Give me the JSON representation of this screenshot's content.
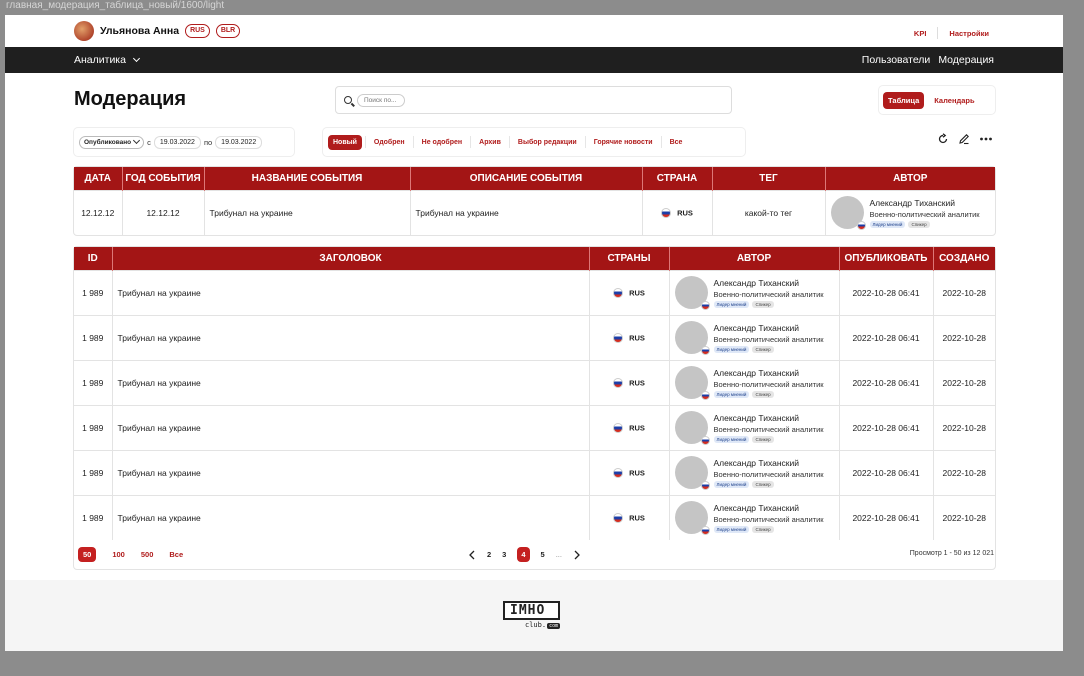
{
  "frame_title": "главная_модерация_таблица_новый/1600/light",
  "user": {
    "name": "Ульянова Анна",
    "langs": [
      "RUS",
      "BLR"
    ]
  },
  "top_links": {
    "kpi": "KPI",
    "settings": "Настройки"
  },
  "nav": {
    "analytics": "Аналитика",
    "users": "Пользователи",
    "moderation": "Модерация"
  },
  "page": {
    "title": "Модерация"
  },
  "search": {
    "placeholder": "Поиск по..."
  },
  "view_tabs": {
    "table": "Таблица",
    "calendar": "Календарь",
    "active": "Таблица"
  },
  "filters": {
    "status_select": "Опубликовано",
    "from_label": "с",
    "from_date": "19.03.2022",
    "to_label": "по",
    "to_date": "19.03.2022"
  },
  "status_tabs": [
    "Новый",
    "Одобрен",
    "Не одобрен",
    "Архив",
    "Выбор редакции",
    "Горячие новости",
    "Все"
  ],
  "status_active": "Новый",
  "events_table": {
    "headers": [
      "ДАТА",
      "ГОД СОБЫТИЯ",
      "НАЗВАНИЕ СОБЫТИЯ",
      "ОПИСАНИЕ СОБЫТИЯ",
      "СТРАНА",
      "ТЕГ",
      "АВТОР"
    ],
    "row": {
      "date": "12.12.12",
      "year": "12.12.12",
      "name": "Трибунал на украине",
      "description": "Трибунал на украине",
      "country": "RUS",
      "tag": "какой-то тег",
      "author_name": "Александр Тиханский",
      "author_role": "Военно-политический аналитик",
      "author_tags": [
        "Лидер мнений",
        "Спикер"
      ]
    }
  },
  "articles_table": {
    "headers": [
      "ID",
      "ЗАГОЛОВОК",
      "СТРАНЫ",
      "АВТОР",
      "ОПУБЛИКОВАТЬ",
      "СОЗДАНО"
    ],
    "rows": [
      {
        "id": "1 989",
        "title": "Трибунал на украине",
        "country": "RUS",
        "author_name": "Александр Тиханский",
        "author_role": "Военно-политический аналитик",
        "tag1": "Лидер мнений",
        "tag2": "Спикер",
        "publish": "2022-10-28 06:41",
        "created": "2022-10-28"
      },
      {
        "id": "1 989",
        "title": "Трибунал на украине",
        "country": "RUS",
        "author_name": "Александр Тиханский",
        "author_role": "Военно-политический аналитик",
        "tag1": "Лидер мнений",
        "tag2": "Спикер",
        "publish": "2022-10-28 06:41",
        "created": "2022-10-28"
      },
      {
        "id": "1 989",
        "title": "Трибунал на украине",
        "country": "RUS",
        "author_name": "Александр Тиханский",
        "author_role": "Военно-политический аналитик",
        "tag1": "Лидер мнений",
        "tag2": "Спикер",
        "publish": "2022-10-28 06:41",
        "created": "2022-10-28"
      },
      {
        "id": "1 989",
        "title": "Трибунал на украине",
        "country": "RUS",
        "author_name": "Александр Тиханский",
        "author_role": "Военно-политический аналитик",
        "tag1": "Лидер мнений",
        "tag2": "Спикер",
        "publish": "2022-10-28 06:41",
        "created": "2022-10-28"
      },
      {
        "id": "1 989",
        "title": "Трибунал на украине",
        "country": "RUS",
        "author_name": "Александр Тиханский",
        "author_role": "Военно-политический аналитик",
        "tag1": "Лидер мнений",
        "tag2": "Спикер",
        "publish": "2022-10-28 06:41",
        "created": "2022-10-28"
      },
      {
        "id": "1 989",
        "title": "Трибунал на украине",
        "country": "RUS",
        "author_name": "Александр Тиханский",
        "author_role": "Военно-политический аналитик",
        "tag1": "Лидер мнений",
        "tag2": "Спикер",
        "publish": "2022-10-28 06:41",
        "created": "2022-10-28"
      }
    ]
  },
  "pagination": {
    "sizes": [
      "50",
      "100",
      "500",
      "Все"
    ],
    "active_size": "50",
    "pages": [
      "2",
      "3",
      "4",
      "5",
      "..."
    ],
    "active_page": "4",
    "view_info": "Просмотр 1 - 50 из 12 021"
  },
  "footer": {
    "logo": "IMHO",
    "logo_sub": "club.",
    "logo_badge": "com"
  },
  "colors": {
    "accent": "#a31515",
    "dark_nav": "#1f1f1f"
  },
  "icons": [
    "search-icon",
    "chevron-down-icon",
    "refresh-icon",
    "edit-icon",
    "more-icon",
    "chevron-left-icon",
    "chevron-right-icon",
    "flag-rus-icon"
  ]
}
